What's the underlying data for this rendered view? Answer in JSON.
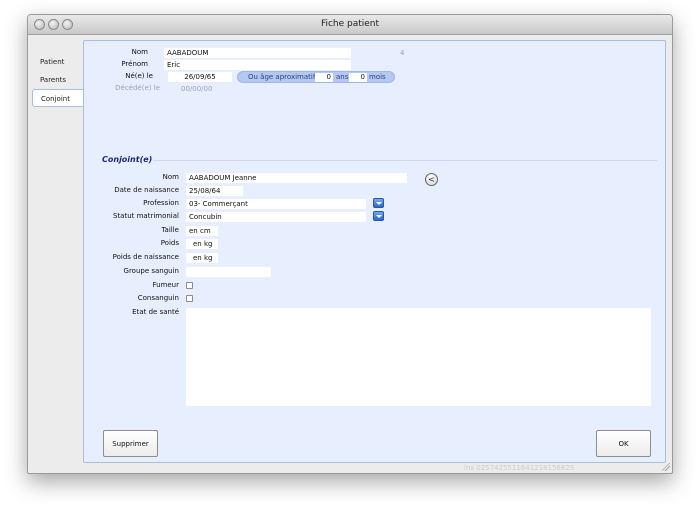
{
  "window": {
    "title": "Fiche patient"
  },
  "tabs": [
    {
      "label": "Patient"
    },
    {
      "label": "Parents"
    },
    {
      "label": "Conjoint"
    }
  ],
  "patient": {
    "nom_label": "Nom",
    "nom": "AABADOUM",
    "id": "4",
    "prenom_label": "Prénom",
    "prenom": "Eric",
    "ne_label": "Né(e) le",
    "ne": "26/09/65",
    "age_approx_label": "Ou âge aproximatif",
    "age_ans": "0",
    "ans_label": "ans",
    "age_mois": "0",
    "mois_label": "mois",
    "decede_label": "Décédé(e) le",
    "decede": "00/00/00"
  },
  "conjoint": {
    "section_title": "Conjoint(e)",
    "nom_label": "Nom",
    "nom": "AABADOUM Jeanne",
    "back_button": "<",
    "dob_label": "Date de naissance",
    "dob": "25/08/64",
    "profession_label": "Profession",
    "profession": "03- Commerçant",
    "statut_label": "Statut matrimonial",
    "statut": "Concubin",
    "taille_label": "Taille",
    "taille_unit": "en cm",
    "poids_label": "Poids",
    "poids_unit": "en kg",
    "poids_naissance_label": "Poids de naissance",
    "poids_naissance_unit": "en kg",
    "groupe_label": "Groupe sanguin",
    "groupe": "",
    "fumeur_label": "Fumeur",
    "consanguin_label": "Consanguin",
    "etat_label": "Etat de santé",
    "etat": ""
  },
  "buttons": {
    "supprimer": "Supprimer",
    "ok": "OK"
  },
  "footer": {
    "ins": "ins 0257425511641218156825"
  }
}
